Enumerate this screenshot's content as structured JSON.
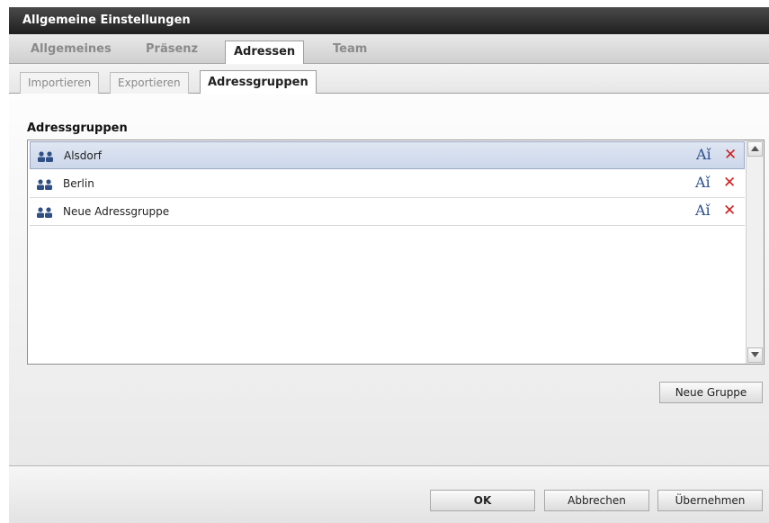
{
  "window": {
    "title": "Allgemeine Einstellungen"
  },
  "tabs": [
    {
      "label": "Allgemeines",
      "active": false
    },
    {
      "label": "Präsenz",
      "active": false
    },
    {
      "label": "Adressen",
      "active": true
    },
    {
      "label": "Team",
      "active": false
    }
  ],
  "subtabs": [
    {
      "label": "Importieren",
      "active": false
    },
    {
      "label": "Exportieren",
      "active": false
    },
    {
      "label": "Adressgruppen",
      "active": true
    }
  ],
  "section": {
    "title": "Adressgruppen"
  },
  "groups": [
    {
      "name": "Alsdorf",
      "selected": true
    },
    {
      "name": "Berlin",
      "selected": false
    },
    {
      "name": "Neue Adressgruppe",
      "selected": false
    }
  ],
  "icons": {
    "group": "group-icon",
    "rename": "rename-icon",
    "delete": "delete-icon"
  },
  "icon_glyphs": {
    "rename": "Aǐ",
    "delete": "✕"
  },
  "buttons": {
    "new_group": "Neue Gruppe",
    "ok": "OK",
    "cancel": "Abbrechen",
    "apply": "Übernehmen"
  },
  "colors": {
    "accent": "#2c4f8c",
    "delete": "#d21f1f",
    "selection": "#d3dcee"
  }
}
